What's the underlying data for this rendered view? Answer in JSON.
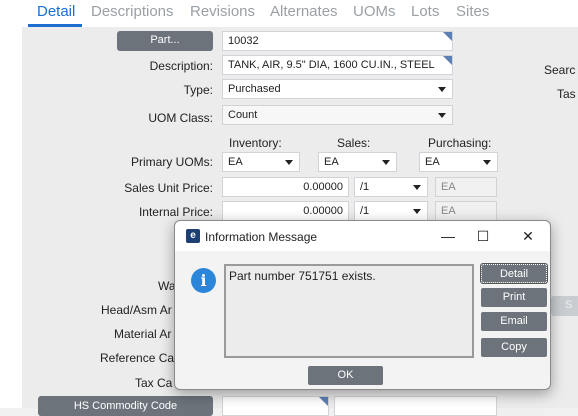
{
  "tabs": [
    {
      "label": "Detail",
      "active": true
    },
    {
      "label": "Descriptions"
    },
    {
      "label": "Revisions"
    },
    {
      "label": "Alternates"
    },
    {
      "label": "UOMs"
    },
    {
      "label": "Lots"
    },
    {
      "label": "Sites"
    }
  ],
  "form": {
    "part_button": "Part...",
    "part_value": "10032",
    "description_label": "Description:",
    "description_value": "TANK, AIR, 9.5\" DIA, 1600 CU.IN., STEEL",
    "type_label": "Type:",
    "type_value": "Purchased",
    "uom_class_label": "UOM Class:",
    "uom_class_value": "Count",
    "col_inventory": "Inventory:",
    "col_sales": "Sales:",
    "col_purchasing": "Purchasing:",
    "primary_uoms_label": "Primary UOMs:",
    "inv_uom": "EA",
    "sales_uom": "EA",
    "purch_uom": "EA",
    "sales_price_label": "Sales Unit Price:",
    "sales_price_value": "0.00000",
    "sales_per": "/1",
    "sales_price_uom": "EA",
    "internal_price_label": "Internal Price:",
    "internal_price_value": "0.00000",
    "internal_per": "/1",
    "internal_price_uom": "EA",
    "partial_labels": [
      "Wa",
      "Head/Asm Ar",
      "Material Ar",
      "Reference Ca",
      "Tax Ca"
    ],
    "hs_button": "HS Commodity Code"
  },
  "right_panel": {
    "search_label": "Searc",
    "tas_label": "Tas",
    "partial_button": "S"
  },
  "dialog": {
    "title": "Information Message",
    "message": "Part number 751751 exists.",
    "buttons": [
      "Detail",
      "Print",
      "Email",
      "Copy"
    ],
    "ok": "OK",
    "controls": {
      "minimize": "—",
      "maximize": "☐",
      "close": "✕"
    }
  }
}
